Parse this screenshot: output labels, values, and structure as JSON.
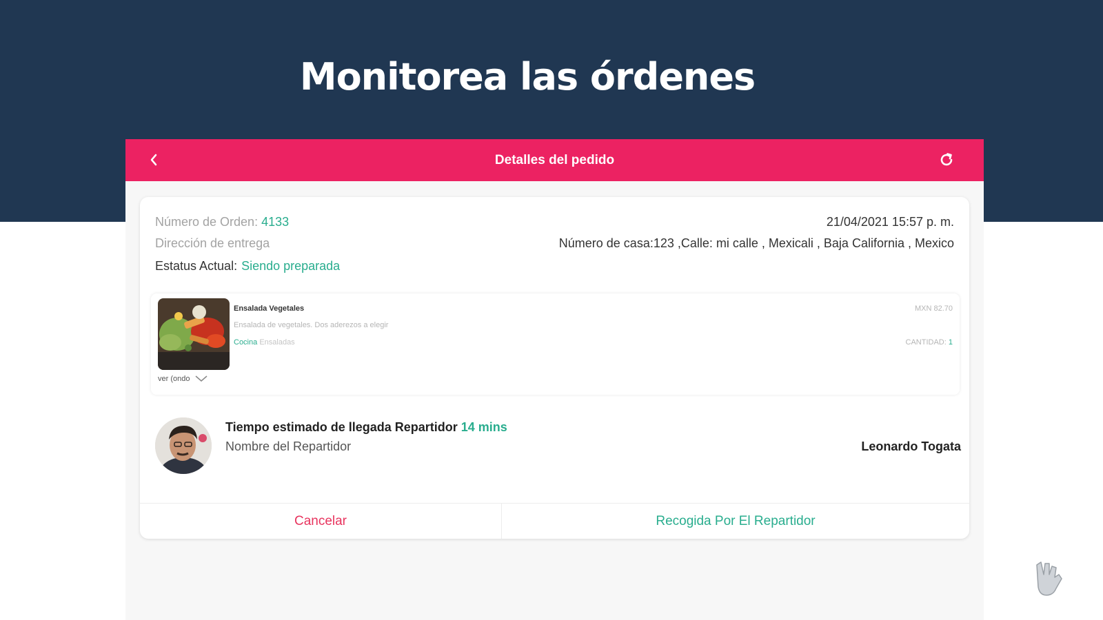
{
  "headline": "Monitorea las órdenes",
  "appbar": {
    "title": "Detalles del pedido",
    "back_icon": "chevron-left-icon",
    "refresh_icon": "refresh-icon"
  },
  "order": {
    "number_label": "Número de Orden:",
    "number": "4133",
    "datetime": "21/04/2021 15:57 p. m.",
    "address_label": "Dirección de entrega",
    "address": "Número de casa:123 ,Calle: mi calle , Mexicali , Baja California , Mexico",
    "status_label": "Estatus Actual:",
    "status": "Siendo preparada"
  },
  "item": {
    "name": "Ensalada Vegetales",
    "description": "Ensalada de vegetales. Dos aderezos a elegir",
    "category": "Cocina",
    "subcategory": "Ensaladas",
    "price": "MXN 82.70",
    "qty_label": "CANTIDAD:",
    "qty": "1",
    "toggle_label": "ver (ondo"
  },
  "delivery": {
    "eta_label": "Tiempo estimado de llegada Repartidor",
    "eta": "14 mins",
    "driver_label": "Nombre del Repartidor",
    "driver_name": "Leonardo Togata"
  },
  "actions": {
    "cancel": "Cancelar",
    "pickup": "Recogida Por El Repartidor"
  },
  "colors": {
    "navy": "#203752",
    "pink": "#ec2262",
    "teal": "#29ad8e",
    "cancel": "#e8345e"
  }
}
